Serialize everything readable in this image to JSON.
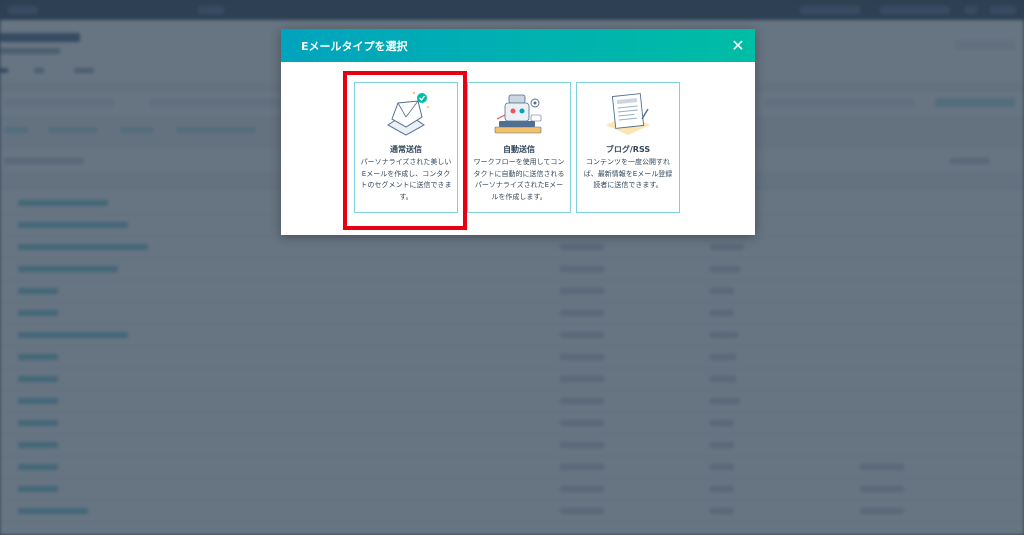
{
  "modal": {
    "title": "Eメールタイプを選択",
    "close_icon": "close-icon",
    "options": [
      {
        "title": "通常送信",
        "description": "パーソナライズされた美しい\nEメールを作成し、コンタク\nトのセグメントに送信できま\nす。",
        "icon": "envelope-check-illustration"
      },
      {
        "title": "自動送信",
        "description": "ワークフローを使用してコン\nタクトに自動的に送信される\nパーソナライズされたEメー\nルを作成します。",
        "icon": "robot-automation-illustration"
      },
      {
        "title": "ブログ/RSS",
        "description": "コンテンツを一度公開すれ\nば、最新情報をEメール登録\n読者に送信できます。",
        "icon": "blog-rss-illustration"
      }
    ]
  },
  "colors": {
    "header_gradient_start": "#00a4bd",
    "header_gradient_end": "#00bda5",
    "card_border": "#7fd1de",
    "highlight": "#e60012",
    "text": "#33475b"
  }
}
